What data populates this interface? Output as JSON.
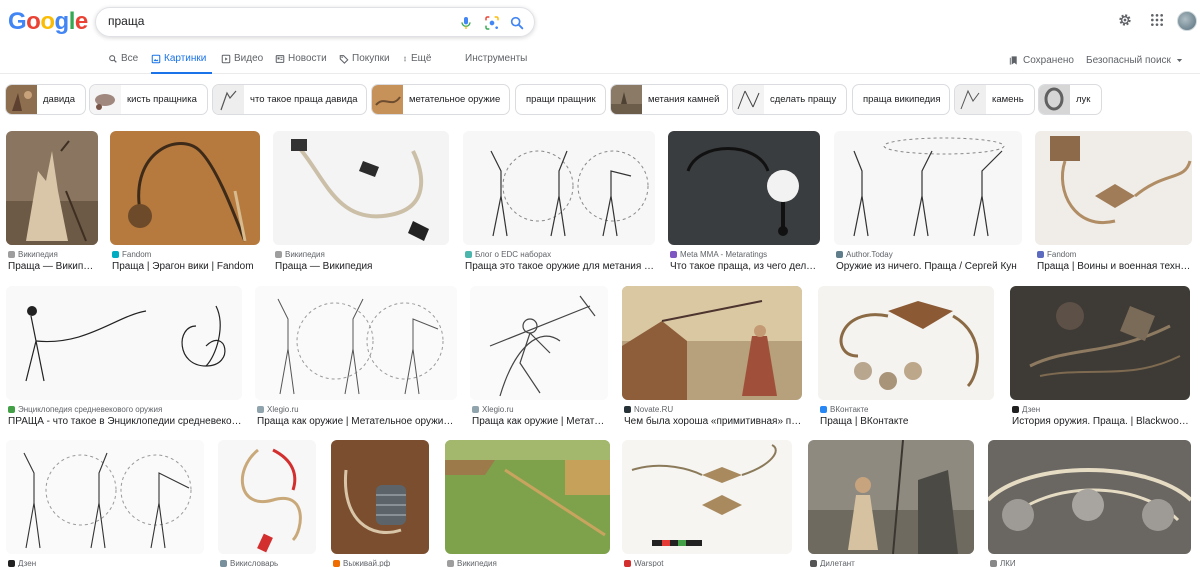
{
  "logo": {
    "g1": "G",
    "o1": "o",
    "o2": "o",
    "g2": "g",
    "l": "l",
    "e": "e"
  },
  "search": {
    "query": "праща"
  },
  "tabs": [
    {
      "label": "Все",
      "icon": "search-icon"
    },
    {
      "label": "Картинки",
      "icon": "image-icon",
      "active": true
    },
    {
      "label": "Видео",
      "icon": "play-icon"
    },
    {
      "label": "Новости",
      "icon": "news-icon"
    },
    {
      "label": "Покупки",
      "icon": "tag-icon"
    },
    {
      "label": "Ещё",
      "icon": "more-vert-icon"
    }
  ],
  "tools_label": "Инструменты",
  "saved_label": "Сохранено",
  "safe_search_label": "Безопасный поиск",
  "chips": [
    {
      "label": "давида",
      "thumb": "#8d6e4e"
    },
    {
      "label": "кисть пращника",
      "thumb": "#a1887f"
    },
    {
      "label": "что такое праща давида",
      "thumb": "#eeeeee"
    },
    {
      "label": "метательное оружие",
      "thumb": "#c7925a"
    },
    {
      "label": "пращи пращник",
      "thumb": ""
    },
    {
      "label": "метания камней",
      "thumb": "#8a7a66"
    },
    {
      "label": "сделать пращу",
      "thumb": "#e8e8e8"
    },
    {
      "label": "праща википедия",
      "thumb": ""
    },
    {
      "label": "камень",
      "thumb": "#efefef"
    },
    {
      "label": "лук",
      "thumb": "#9e9e9e"
    }
  ],
  "results": [
    {
      "source": "Википедия",
      "title": "Праща — Википедия",
      "fav": "#9e9e9e"
    },
    {
      "source": "Fandom",
      "title": "Праща | Эрагон вики | Fandom",
      "fav": "#00acc1"
    },
    {
      "source": "Википедия",
      "title": "Праща — Википедия",
      "fav": "#9e9e9e"
    },
    {
      "source": "Блог о EDC наборах",
      "title": "Праща это такое оружие для метания ка...",
      "fav": "#4db6ac"
    },
    {
      "source": "Meta MMA - Metaratings",
      "title": "Что такое праща, из чего делает...",
      "fav": "#7e57c2"
    },
    {
      "source": "Author.Today",
      "title": "Оружие из ничего. Праща / Сергей Кун",
      "fav": "#607d8b"
    },
    {
      "source": "Fandom",
      "title": "Праща | Воины и военная техник...",
      "fav": "#5c6bc0"
    },
    {
      "source": "Энциклопедия средневекового оружия",
      "title": "ПРАЩА - что такое в Энциклопедии средневековог...",
      "fav": "#43a047"
    },
    {
      "source": "Xlegio.ru",
      "title": "Праща как оружие | Метательное оружие | ...",
      "fav": "#90a4ae"
    },
    {
      "source": "Xlegio.ru",
      "title": "Праща как оружие | Метател...",
      "fav": "#90a4ae"
    },
    {
      "source": "Novate.RU",
      "title": "Чем была хороша «примитивная» пращ...",
      "fav": "#263238"
    },
    {
      "source": "ВКонтакте",
      "title": "Праща | ВКонтакте",
      "fav": "#2787f5"
    },
    {
      "source": "Дзен",
      "title": "История оружия. Праща. | Blackwood his...",
      "fav": "#212121"
    },
    {
      "source": "Дзен",
      "title": "",
      "fav": "#212121"
    },
    {
      "source": "Викисловарь",
      "title": "",
      "fav": "#78909c"
    },
    {
      "source": "Выживай.рф",
      "title": "",
      "fav": "#ef6c00"
    },
    {
      "source": "Википедия",
      "title": "",
      "fav": "#9e9e9e"
    },
    {
      "source": "Warspot",
      "title": "",
      "fav": "#d32f2f"
    },
    {
      "source": "Дилетант",
      "title": "",
      "fav": "#555555"
    },
    {
      "source": "ЛКИ",
      "title": "",
      "fav": "#888888"
    }
  ],
  "colors": {
    "accent": "#1a73e8",
    "text": "#202124",
    "muted": "#5f6368"
  }
}
